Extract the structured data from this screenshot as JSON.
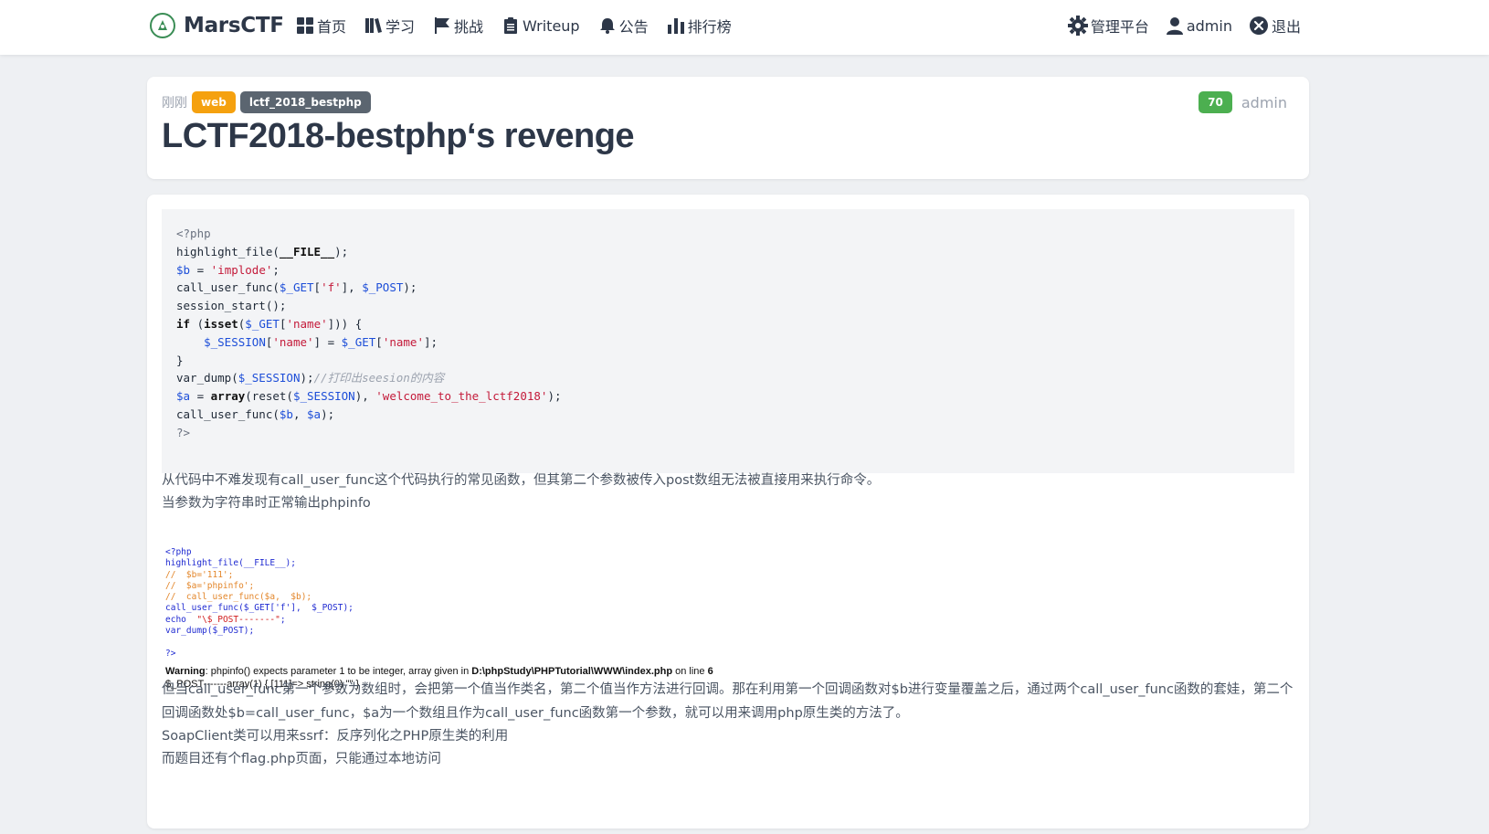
{
  "nav": {
    "brand": "MarsCTF",
    "left": [
      {
        "label": "首页",
        "icon": "grid-icon"
      },
      {
        "label": "学习",
        "icon": "book-icon"
      },
      {
        "label": "挑战",
        "icon": "flag-icon"
      },
      {
        "label": "Writeup",
        "icon": "clipboard-icon"
      },
      {
        "label": "公告",
        "icon": "bell-icon"
      },
      {
        "label": "排行榜",
        "icon": "bar-chart-icon"
      }
    ],
    "right": [
      {
        "label": "管理平台",
        "icon": "gear-icon"
      },
      {
        "label": "admin",
        "icon": "user-icon"
      },
      {
        "label": "退出",
        "icon": "close-circle-icon"
      }
    ]
  },
  "post": {
    "time": "刚刚",
    "tags": [
      "web",
      "lctf_2018_bestphp"
    ],
    "score": "70",
    "author": "admin",
    "title": "LCTF2018-bestphp‘s revenge"
  },
  "paragraphs": {
    "p1": "从代码中不难发现有call_user_func这个代码执行的常见函数，但其第二个参数被传入post数组无法被直接用来执行命令。",
    "p2": "当参数为字符串时正常输出phpinfo",
    "p3": "但当call_user_func第一个参数为数组时，会把第一个值当作类名，第二个值当作方法进行回调。那在利用第一个回调函数对$b进行变量覆盖之后，通过两个call_user_func函数的套娃，第二个回调函数处$b=call_user_func，$a为一个数组且作为call_user_func函数第一个参数，就可以用来调用php原生类的方法了。",
    "p4": "SoapClient类可以用来ssrf：反序列化之PHP原生类的利用",
    "p5": "而题目还有个flag.php页面，只能通过本地访问"
  },
  "screenshot_text": {
    "warning_label": "Warning",
    "warning_msg": ": phpinfo() expects parameter 1 to be integer, array given in ",
    "warning_path": "D:\\phpStudy\\PHPTutorial\\WWW\\index.php",
    "warning_line_label": " on line ",
    "warning_line": "6",
    "dump": "$_POST-------array(1) { [111]=> string(0) \"\" }"
  }
}
